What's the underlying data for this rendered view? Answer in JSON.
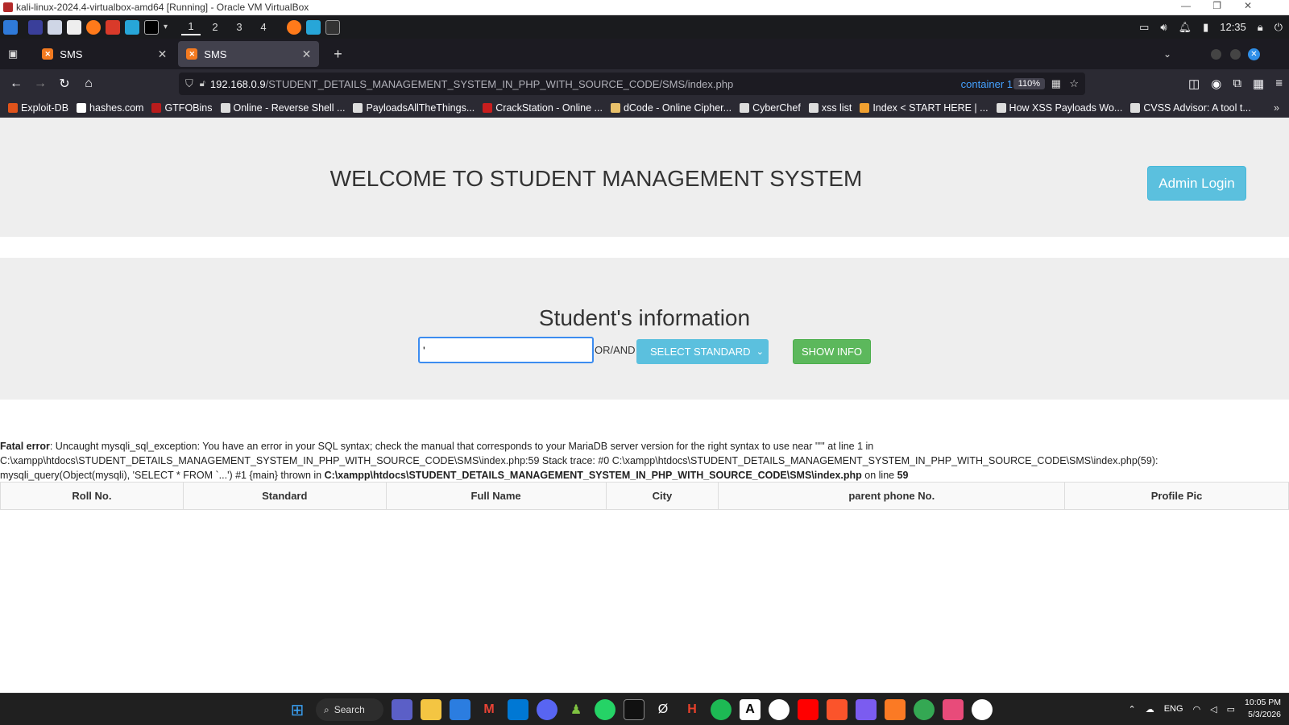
{
  "vbox": {
    "title": "kali-linux-2024.4-virtualbox-amd64 [Running] - Oracle VM VirtualBox"
  },
  "kali_panel": {
    "workspaces": [
      "1",
      "2",
      "3",
      "4"
    ],
    "time": "12:35"
  },
  "browser": {
    "tabs": [
      {
        "label": "SMS",
        "active": false
      },
      {
        "label": "SMS",
        "active": true
      }
    ],
    "url_host": "192.168.0.9",
    "url_path": "/STUDENT_DETAILS_MANAGEMENT_SYSTEM_IN_PHP_WITH_SOURCE_CODE/SMS/index.php",
    "container": "container 1",
    "zoom": "110%",
    "bookmarks": [
      {
        "label": "Exploit-DB",
        "color": "#e0531b"
      },
      {
        "label": "hashes.com",
        "color": "#ffffff"
      },
      {
        "label": "GTFOBins",
        "color": "#b91c1c"
      },
      {
        "label": "Online - Reverse Shell ...",
        "color": "#dddddd"
      },
      {
        "label": "PayloadsAllTheThings...",
        "color": "#dddddd"
      },
      {
        "label": "CrackStation - Online ...",
        "color": "#c81e1e"
      },
      {
        "label": "dCode - Online Cipher...",
        "color": "#e8c06a"
      },
      {
        "label": "CyberChef",
        "color": "#dddddd"
      },
      {
        "label": "xss list",
        "color": "#dddddd"
      },
      {
        "label": "Index < START HERE | ...",
        "color": "#f0a030"
      },
      {
        "label": "How XSS Payloads Wo...",
        "color": "#dddddd"
      },
      {
        "label": "CVSS Advisor: A tool t...",
        "color": "#dddddd"
      }
    ]
  },
  "page": {
    "title": "WELCOME TO STUDENT MANAGEMENT SYSTEM",
    "admin_login": "Admin Login",
    "section_title": "Student's information",
    "search_value": "'",
    "or_and": "OR/AND",
    "select_standard": "SELECT STANDARD",
    "show_info": "SHOW INFO",
    "error": {
      "label": "Fatal error",
      "message": ": Uncaught mysqli_sql_exception: You have an error in your SQL syntax; check the manual that corresponds to your MariaDB server version for the right syntax to use near ''''' at line 1 in C:\\xampp\\htdocs\\STUDENT_DETAILS_MANAGEMENT_SYSTEM_IN_PHP_WITH_SOURCE_CODE\\SMS\\index.php:59 Stack trace: #0 C:\\xampp\\htdocs\\STUDENT_DETAILS_MANAGEMENT_SYSTEM_IN_PHP_WITH_SOURCE_CODE\\SMS\\index.php(59): mysqli_query(Object(mysqli), 'SELECT * FROM `...') #1 {main} thrown in ",
      "file": "C:\\xampp\\htdocs\\STUDENT_DETAILS_MANAGEMENT_SYSTEM_IN_PHP_WITH_SOURCE_CODE\\SMS\\index.php",
      "on_line": " on line ",
      "line": "59"
    },
    "table_headers": [
      "Roll No.",
      "Standard",
      "Full Name",
      "City",
      "parent phone No.",
      "Profile Pic"
    ]
  },
  "windows_taskbar": {
    "search_label": "Search",
    "lang": "ENG",
    "time": "10:05 PM",
    "date": "5/3/2026"
  }
}
